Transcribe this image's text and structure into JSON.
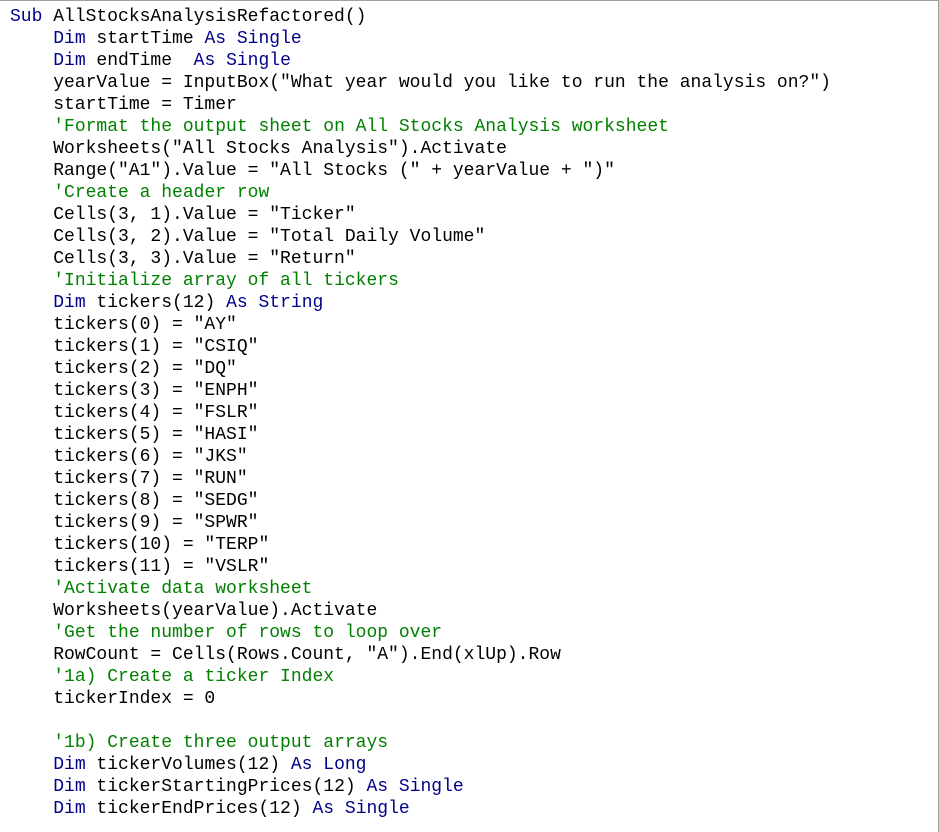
{
  "editor": {
    "colors": {
      "keyword": "#00008b",
      "comment": "#008000",
      "text": "#000000",
      "background": "#ffffff"
    },
    "lines": [
      [
        {
          "t": "Sub",
          "c": "kw"
        },
        {
          "t": " AllStocksAnalysisRefactored()",
          "c": ""
        }
      ],
      [
        {
          "t": "    ",
          "c": ""
        },
        {
          "t": "Dim",
          "c": "kw"
        },
        {
          "t": " startTime ",
          "c": ""
        },
        {
          "t": "As",
          "c": "kw"
        },
        {
          "t": " ",
          "c": ""
        },
        {
          "t": "Single",
          "c": "kw"
        }
      ],
      [
        {
          "t": "    ",
          "c": ""
        },
        {
          "t": "Dim",
          "c": "kw"
        },
        {
          "t": " endTime  ",
          "c": ""
        },
        {
          "t": "As",
          "c": "kw"
        },
        {
          "t": " ",
          "c": ""
        },
        {
          "t": "Single",
          "c": "kw"
        }
      ],
      [
        {
          "t": "    yearValue = InputBox(\"What year would you like to run the analysis on?\")",
          "c": ""
        }
      ],
      [
        {
          "t": "    startTime = Timer",
          "c": ""
        }
      ],
      [
        {
          "t": "    ",
          "c": ""
        },
        {
          "t": "'Format the output sheet on All Stocks Analysis worksheet",
          "c": "cm"
        }
      ],
      [
        {
          "t": "    Worksheets(\"All Stocks Analysis\").Activate",
          "c": ""
        }
      ],
      [
        {
          "t": "    Range(\"A1\").Value = \"All Stocks (\" + yearValue + \")\"",
          "c": ""
        }
      ],
      [
        {
          "t": "    ",
          "c": ""
        },
        {
          "t": "'Create a header row",
          "c": "cm"
        }
      ],
      [
        {
          "t": "    Cells(3, 1).Value = \"Ticker\"",
          "c": ""
        }
      ],
      [
        {
          "t": "    Cells(3, 2).Value = \"Total Daily Volume\"",
          "c": ""
        }
      ],
      [
        {
          "t": "    Cells(3, 3).Value = \"Return\"",
          "c": ""
        }
      ],
      [
        {
          "t": "    ",
          "c": ""
        },
        {
          "t": "'Initialize array of all tickers",
          "c": "cm"
        }
      ],
      [
        {
          "t": "    ",
          "c": ""
        },
        {
          "t": "Dim",
          "c": "kw"
        },
        {
          "t": " tickers(12) ",
          "c": ""
        },
        {
          "t": "As",
          "c": "kw"
        },
        {
          "t": " ",
          "c": ""
        },
        {
          "t": "String",
          "c": "kw"
        }
      ],
      [
        {
          "t": "    tickers(0) = \"AY\"",
          "c": ""
        }
      ],
      [
        {
          "t": "    tickers(1) = \"CSIQ\"",
          "c": ""
        }
      ],
      [
        {
          "t": "    tickers(2) = \"DQ\"",
          "c": ""
        }
      ],
      [
        {
          "t": "    tickers(3) = \"ENPH\"",
          "c": ""
        }
      ],
      [
        {
          "t": "    tickers(4) = \"FSLR\"",
          "c": ""
        }
      ],
      [
        {
          "t": "    tickers(5) = \"HASI\"",
          "c": ""
        }
      ],
      [
        {
          "t": "    tickers(6) = \"JKS\"",
          "c": ""
        }
      ],
      [
        {
          "t": "    tickers(7) = \"RUN\"",
          "c": ""
        }
      ],
      [
        {
          "t": "    tickers(8) = \"SEDG\"",
          "c": ""
        }
      ],
      [
        {
          "t": "    tickers(9) = \"SPWR\"",
          "c": ""
        }
      ],
      [
        {
          "t": "    tickers(10) = \"TERP\"",
          "c": ""
        }
      ],
      [
        {
          "t": "    tickers(11) = \"VSLR\"",
          "c": ""
        }
      ],
      [
        {
          "t": "    ",
          "c": ""
        },
        {
          "t": "'Activate data worksheet",
          "c": "cm"
        }
      ],
      [
        {
          "t": "    Worksheets(yearValue).Activate",
          "c": ""
        }
      ],
      [
        {
          "t": "    ",
          "c": ""
        },
        {
          "t": "'Get the number of rows to loop over",
          "c": "cm"
        }
      ],
      [
        {
          "t": "    RowCount = Cells(Rows.Count, \"A\").End(xlUp).Row",
          "c": ""
        }
      ],
      [
        {
          "t": "    ",
          "c": ""
        },
        {
          "t": "'1a) Create a ticker Index",
          "c": "cm"
        }
      ],
      [
        {
          "t": "    tickerIndex = 0",
          "c": ""
        }
      ],
      [
        {
          "t": "",
          "c": ""
        }
      ],
      [
        {
          "t": "    ",
          "c": ""
        },
        {
          "t": "'1b) Create three output arrays",
          "c": "cm"
        }
      ],
      [
        {
          "t": "    ",
          "c": ""
        },
        {
          "t": "Dim",
          "c": "kw"
        },
        {
          "t": " tickerVolumes(12) ",
          "c": ""
        },
        {
          "t": "As",
          "c": "kw"
        },
        {
          "t": " ",
          "c": ""
        },
        {
          "t": "Long",
          "c": "kw"
        }
      ],
      [
        {
          "t": "    ",
          "c": ""
        },
        {
          "t": "Dim",
          "c": "kw"
        },
        {
          "t": " tickerStartingPrices(12) ",
          "c": ""
        },
        {
          "t": "As",
          "c": "kw"
        },
        {
          "t": " ",
          "c": ""
        },
        {
          "t": "Single",
          "c": "kw"
        }
      ],
      [
        {
          "t": "    ",
          "c": ""
        },
        {
          "t": "Dim",
          "c": "kw"
        },
        {
          "t": " tickerEndPrices(12) ",
          "c": ""
        },
        {
          "t": "As",
          "c": "kw"
        },
        {
          "t": " ",
          "c": ""
        },
        {
          "t": "Single",
          "c": "kw"
        }
      ]
    ]
  }
}
